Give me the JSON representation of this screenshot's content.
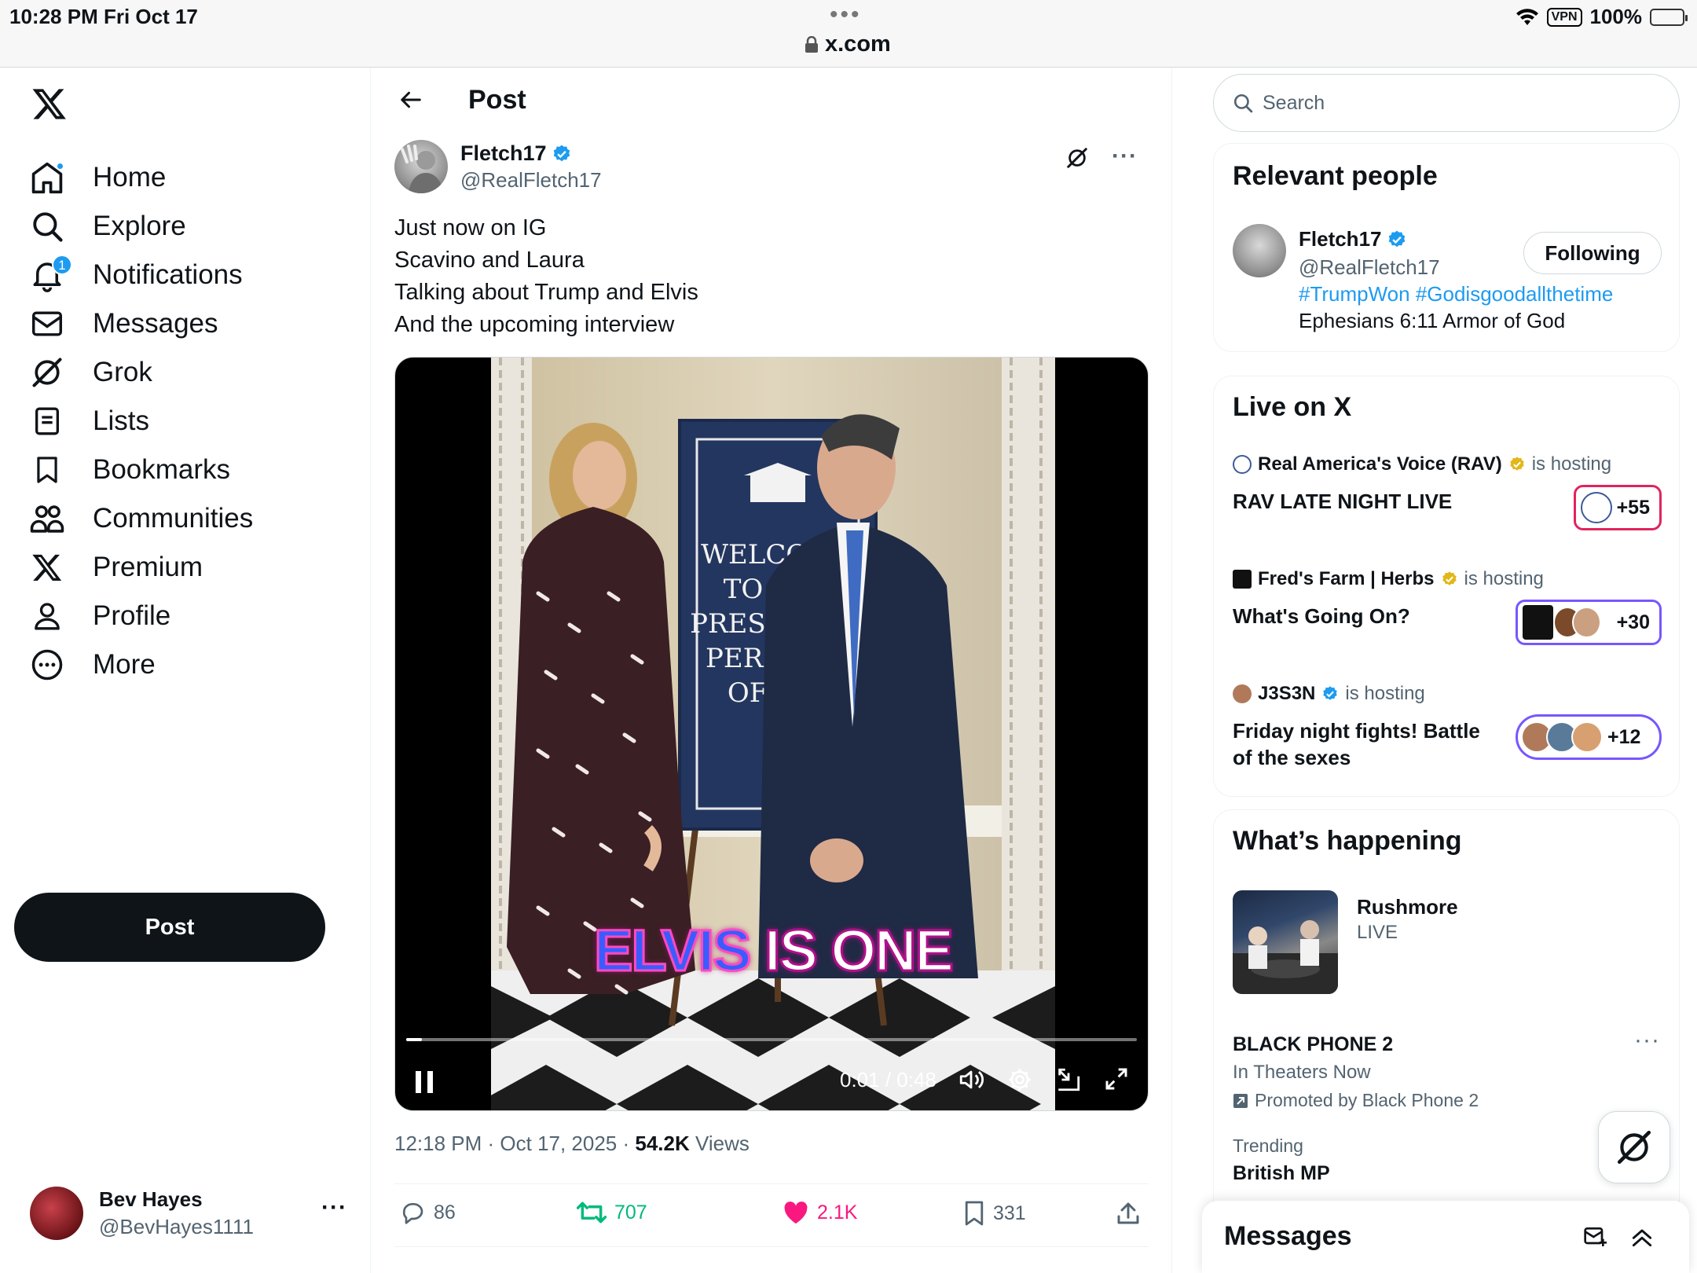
{
  "status_bar": {
    "time": "10:28 PM   Fri Oct 17",
    "url": "x.com",
    "vpn": "VPN",
    "battery": "100%"
  },
  "sidebar": {
    "items": [
      {
        "label": "Home",
        "icon": "home-icon"
      },
      {
        "label": "Explore",
        "icon": "search-icon"
      },
      {
        "label": "Notifications",
        "icon": "bell-icon",
        "badge": "1"
      },
      {
        "label": "Messages",
        "icon": "envelope-icon"
      },
      {
        "label": "Grok",
        "icon": "grok-icon"
      },
      {
        "label": "Lists",
        "icon": "list-icon"
      },
      {
        "label": "Bookmarks",
        "icon": "bookmark-icon"
      },
      {
        "label": "Communities",
        "icon": "people-icon"
      },
      {
        "label": "Premium",
        "icon": "x-logo-icon"
      },
      {
        "label": "Profile",
        "icon": "person-icon"
      },
      {
        "label": "More",
        "icon": "more-circle-icon"
      }
    ],
    "post_button": "Post",
    "account": {
      "name": "Bev Hayes",
      "handle": "@BevHayes1111"
    }
  },
  "main": {
    "title": "Post",
    "author": {
      "name": "Fletch17",
      "handle": "@RealFletch17",
      "verified": true
    },
    "text_lines": [
      "Just now on IG",
      "Scavino and Laura",
      "Talking about Trump and Elvis",
      "And the upcoming interview"
    ],
    "video": {
      "caption_highlight": "ELVIS",
      "caption_rest": " IS ONE",
      "sign_lines": [
        "WELCOME",
        "TO THE",
        "PRESIDENT'",
        "PERSONN",
        "OFFIC!"
      ],
      "time": "0:01 / 0:48",
      "progress": 0.021
    },
    "meta": {
      "time": "12:18 PM · Oct 17, 2025 · ",
      "views": "54.2K",
      "views_label": " Views"
    },
    "actions": {
      "replies": "86",
      "reposts": "707",
      "likes": "2.1K",
      "bookmarks": "331"
    }
  },
  "right": {
    "search_placeholder": "Search",
    "relevant": {
      "title": "Relevant people",
      "name": "Fletch17",
      "handle": "@RealFletch17",
      "bio_tags": "#TrumpWon #Godisgoodallthetime",
      "bio_text": "Ephesians 6:11 Armor of God",
      "follow_label": "Following"
    },
    "live": {
      "title": "Live on X",
      "spaces": [
        {
          "host": "Real America's Voice (RAV)",
          "is_hosting": "is hosting",
          "title": "RAV LATE NIGHT LIVE",
          "count": "+55",
          "border": "#e0245e"
        },
        {
          "host": "Fred's Farm | Herbs",
          "is_hosting": "is hosting",
          "title": "What's Going On?",
          "count": "+30",
          "border": "#7856ff"
        },
        {
          "host": "J3S3N",
          "is_hosting": "is hosting",
          "title": "Friday night fights! Battle of the sexes",
          "count": "+12",
          "border": "#7856ff"
        }
      ]
    },
    "happening": {
      "title": "What’s happening",
      "rushmore_title": "Rushmore",
      "rushmore_status": "LIVE",
      "promo_title": "BLACK PHONE 2",
      "promo_sub": "In Theaters Now",
      "promo_by": "Promoted by Black Phone 2",
      "trend_label": "Trending",
      "trend_title": "British MP"
    },
    "messages_drawer": "Messages"
  },
  "colors": {
    "accent": "#1d9bf0",
    "repost": "#00ba7c",
    "like": "#f91880",
    "text": "#0f1419",
    "secondary": "#536471"
  }
}
